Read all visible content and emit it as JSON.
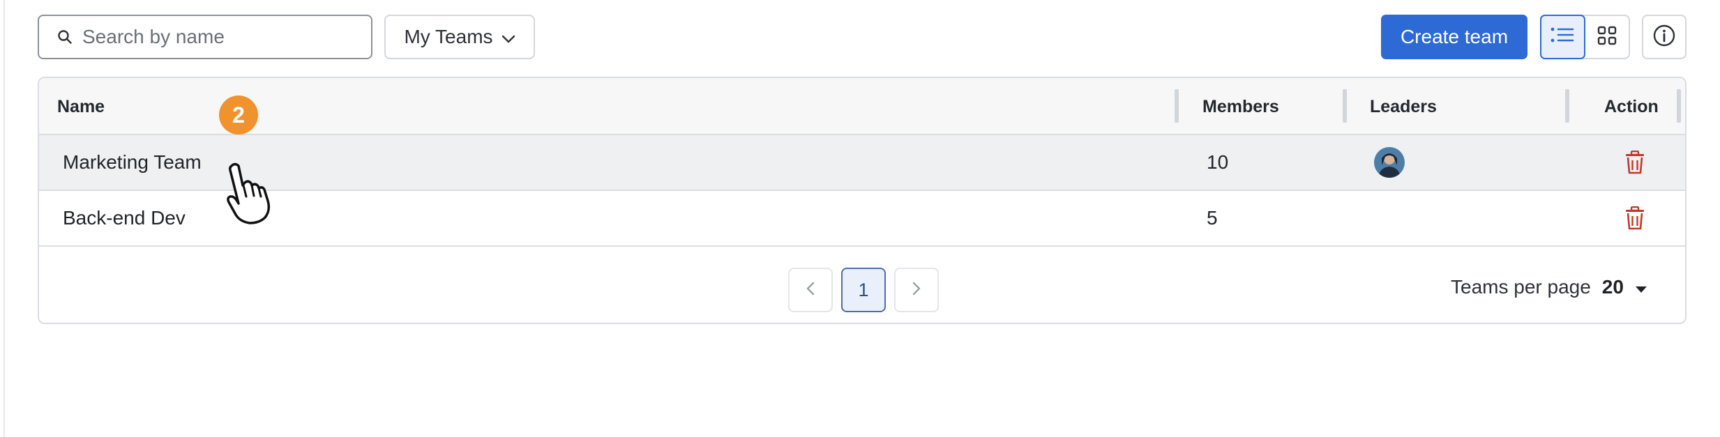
{
  "toolbar": {
    "search_placeholder": "Search by name",
    "filter_label": "My Teams",
    "create_label": "Create team",
    "view_list_icon": "list-view-icon",
    "view_grid_icon": "grid-view-icon",
    "info_icon": "info-icon"
  },
  "table": {
    "columns": [
      "Name",
      "Members",
      "Leaders",
      "Action"
    ],
    "rows": [
      {
        "name": "Marketing Team",
        "members": "10",
        "has_leader_avatar": true
      },
      {
        "name": "Back-end Dev",
        "members": "5",
        "has_leader_avatar": false
      }
    ]
  },
  "pagination": {
    "current_page": "1",
    "per_page_label": "Teams per page",
    "per_page_value": "20"
  },
  "overlay": {
    "step_badge": "2"
  },
  "colors": {
    "accent": "#2d6ad6",
    "danger": "#c0392b",
    "badge": "#f0922e"
  }
}
